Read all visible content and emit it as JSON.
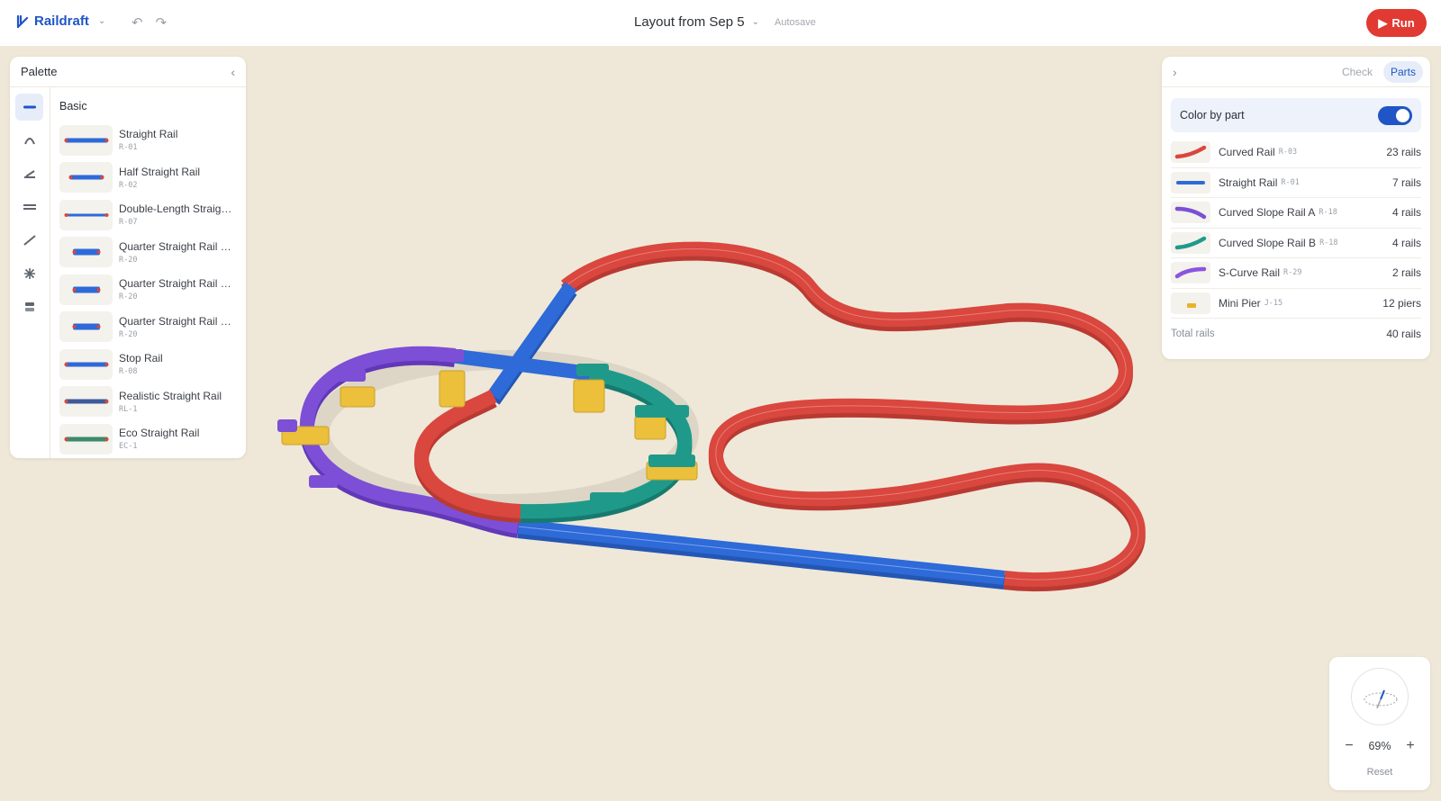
{
  "app": {
    "name": "Raildraft",
    "doc_title": "Layout from Sep 5",
    "autosave": "Autosave",
    "run_label": "Run"
  },
  "palette": {
    "title": "Palette",
    "section": "Basic",
    "categories": [
      "straight",
      "curve",
      "slope",
      "double",
      "diagonal",
      "crossing",
      "pier"
    ],
    "items": [
      {
        "name": "Straight Rail",
        "code": "R-01",
        "color": "#2e6ad8"
      },
      {
        "name": "Half Straight Rail",
        "code": "R-02",
        "color": "#2e6ad8"
      },
      {
        "name": "Double-Length Straig…",
        "code": "R-07",
        "color": "#2e6ad8"
      },
      {
        "name": "Quarter Straight Rail …",
        "code": "R-20",
        "color": "#2e6ad8"
      },
      {
        "name": "Quarter Straight Rail …",
        "code": "R-20",
        "color": "#2e6ad8"
      },
      {
        "name": "Quarter Straight Rail …",
        "code": "R-20",
        "color": "#2e6ad8"
      },
      {
        "name": "Stop Rail",
        "code": "R-08",
        "color": "#2e6ad8"
      },
      {
        "name": "Realistic Straight Rail",
        "code": "RL-1",
        "color": "#3d5a9a"
      },
      {
        "name": "Eco Straight Rail",
        "code": "EC-1",
        "color": "#3b8a6a"
      }
    ]
  },
  "parts_panel": {
    "tabs": [
      "Check",
      "Parts"
    ],
    "active_tab": "Parts",
    "toggle_label": "Color by part",
    "toggle_on": true,
    "rows": [
      {
        "name": "Curved Rail",
        "code": "R-03",
        "count": "23 rails",
        "color": "#d9473e"
      },
      {
        "name": "Straight Rail",
        "code": "R-01",
        "count": "7 rails",
        "color": "#2e6ad8"
      },
      {
        "name": "Curved Slope Rail A",
        "code": "R-18",
        "count": "4 rails",
        "color": "#7c4fd6"
      },
      {
        "name": "Curved Slope Rail B",
        "code": "R-18",
        "count": "4 rails",
        "color": "#1f9a8a"
      },
      {
        "name": "S-Curve Rail",
        "code": "R-29",
        "count": "2 rails",
        "color": "#8a55e0"
      },
      {
        "name": "Mini Pier",
        "code": "J-15",
        "count": "12 piers",
        "color": "#e8b32a"
      }
    ],
    "total_label": "Total rails",
    "total_count": "40 rails"
  },
  "zoom": {
    "minus": "−",
    "value": "69%",
    "plus": "+",
    "reset": "Reset"
  },
  "colors": {
    "curved": "#d9473e",
    "straight": "#2e6ad8",
    "slope_a": "#7c4fd6",
    "slope_b": "#1f9a8a",
    "pier": "#ecc03a",
    "accent": "#1f55c6",
    "run": "#e03a33"
  }
}
